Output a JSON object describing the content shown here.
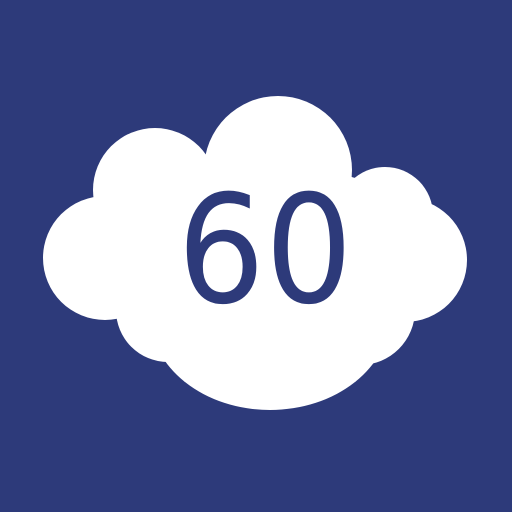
{
  "icon": {
    "label": "60",
    "glyph": "cloud-icon"
  },
  "colors": {
    "background": "#2d3a7a",
    "cloud": "#ffffff",
    "text": "#2d3a7a"
  }
}
